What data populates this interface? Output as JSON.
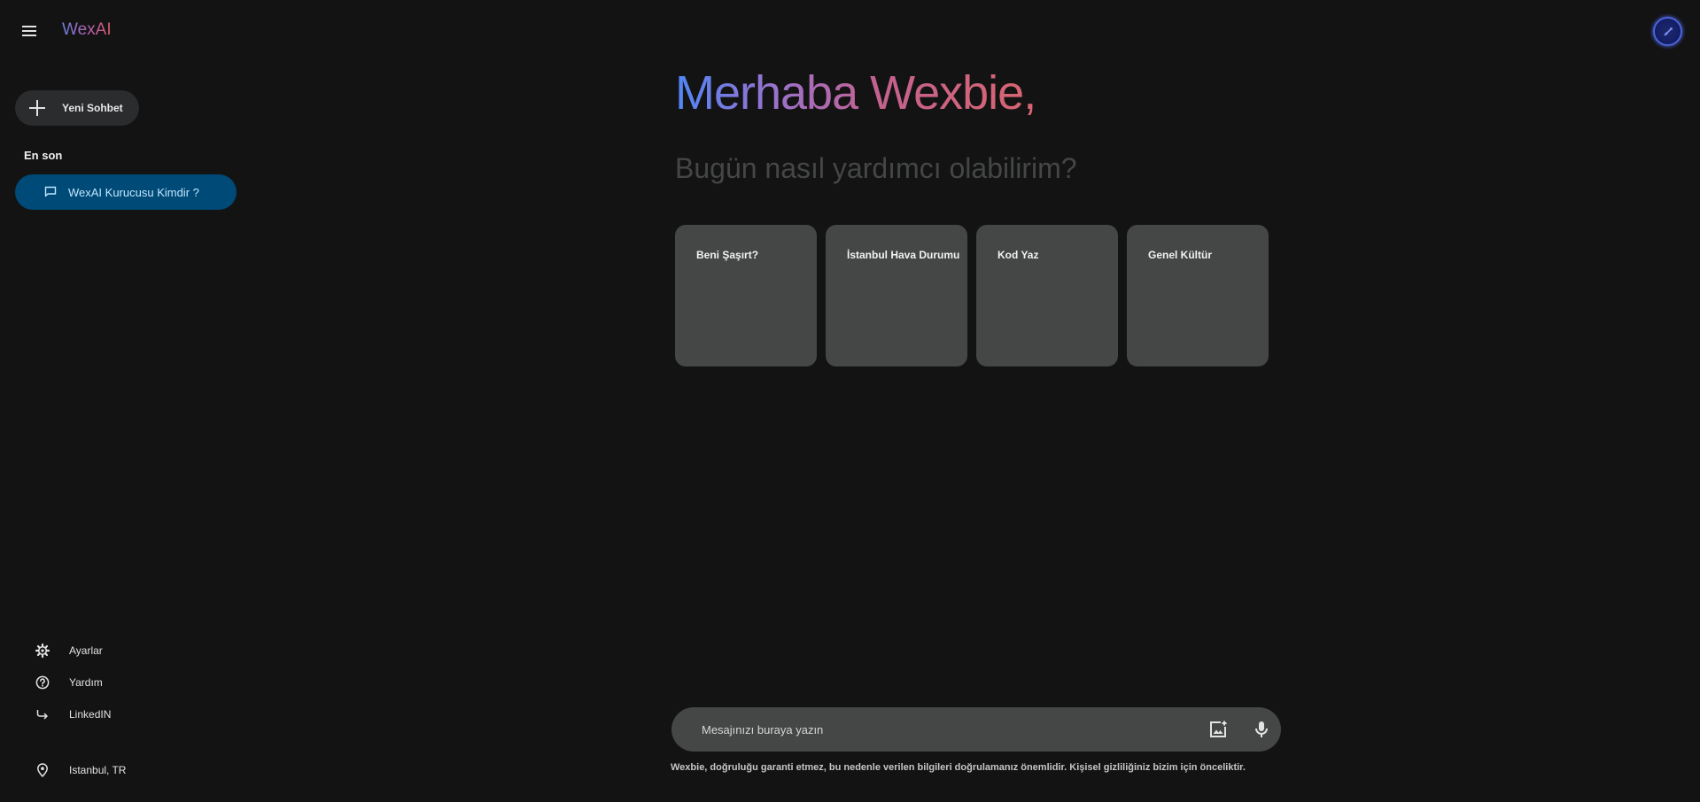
{
  "app": {
    "title": "WexAI"
  },
  "sidebar": {
    "new_chat_label": "Yeni Sohbet",
    "recent_title": "En son",
    "recent_items": [
      {
        "label": "WexAI Kurucusu Kimdir ?"
      }
    ],
    "links": [
      {
        "label": "Ayarlar",
        "icon": "gear-icon"
      },
      {
        "label": "Yardım",
        "icon": "help-icon"
      },
      {
        "label": "LinkedIN",
        "icon": "share-icon"
      }
    ],
    "location": {
      "label": "Istanbul, TR",
      "icon": "location-pin-icon"
    }
  },
  "main": {
    "greeting": "Merhaba Wexbie,",
    "subtitle": "Bugün nasıl yardımcı olabilirim?",
    "cards": [
      {
        "label": "Beni Şaşırt?"
      },
      {
        "label": "İstanbul Hava Durumu"
      },
      {
        "label": "Kod Yaz"
      },
      {
        "label": "Genel Kültür"
      }
    ],
    "input": {
      "placeholder": "Mesajınızı buraya yazın",
      "value": ""
    },
    "disclaimer": "Wexbie, doğruluğu garanti etmez, bu nedenle verilen bilgileri doğrulamanız önemlidir. Kişisel gizliliğiniz bizim için önceliktir."
  },
  "colors": {
    "background": "#131313",
    "card": "#444746",
    "active_item": "#004a77",
    "active_item_text": "#c2e7ff",
    "gradient_start": "#4f86f7",
    "gradient_end": "#d96570"
  }
}
